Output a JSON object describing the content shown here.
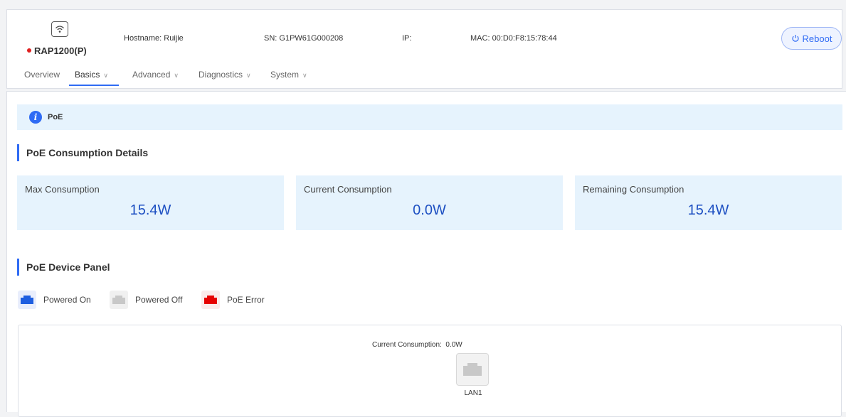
{
  "header": {
    "model": "RAP1200(P)",
    "status_color": "#e02020",
    "hostname_label": "Hostname:",
    "hostname": "Ruijie",
    "sn_label": "SN:",
    "sn": "G1PW61G000208",
    "ip_label": "IP:",
    "ip": "",
    "mac_label": "MAC:",
    "mac": "00:D0:F8:15:78:44",
    "reboot_label": "Reboot",
    "device_icon": "wifi-icon"
  },
  "nav": {
    "tabs": [
      {
        "label": "Overview",
        "has_dropdown": false,
        "active": false
      },
      {
        "label": "Basics",
        "has_dropdown": true,
        "active": true
      },
      {
        "label": "Advanced",
        "has_dropdown": true,
        "active": false
      },
      {
        "label": "Diagnostics",
        "has_dropdown": true,
        "active": false
      },
      {
        "label": "System",
        "has_dropdown": true,
        "active": false
      }
    ],
    "dropdown_icon": "chevron-down-icon"
  },
  "banner": {
    "icon": "info-icon",
    "text": "PoE"
  },
  "consumption": {
    "title": "PoE Consumption Details",
    "cards": [
      {
        "label": "Max Consumption",
        "value": "15.4W"
      },
      {
        "label": "Current Consumption",
        "value": "0.0W"
      },
      {
        "label": "Remaining Consumption",
        "value": "15.4W"
      }
    ]
  },
  "panel": {
    "title": "PoE Device Panel",
    "legend": [
      {
        "label": "Powered On",
        "color": "#1f5fe0"
      },
      {
        "label": "Powered Off",
        "color": "#c8c8c8"
      },
      {
        "label": "PoE Error",
        "color": "#e60000"
      }
    ],
    "current_consumption_label": "Current Consumption:",
    "current_consumption_value": "0.0W",
    "ports": [
      {
        "name": "LAN1",
        "state": "Powered Off"
      }
    ]
  },
  "colors": {
    "accent": "#2f6bf4",
    "card_bg": "#e6f3fd",
    "value_text": "#1d4fc2"
  }
}
